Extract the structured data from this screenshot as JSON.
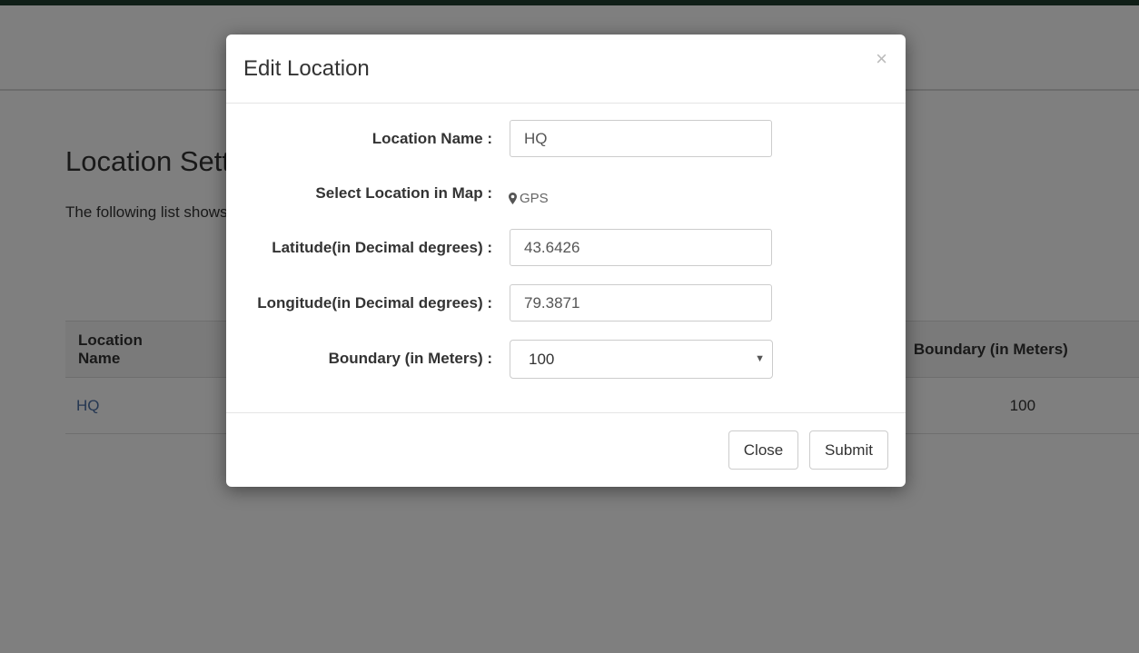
{
  "page": {
    "title": "Location Settings",
    "description": "The following list shows",
    "table": {
      "headers": {
        "name": "Location Name",
        "boundary": "Boundary (in Meters)"
      },
      "rows": [
        {
          "name": "HQ",
          "boundary": "100"
        }
      ]
    }
  },
  "modal": {
    "title": "Edit Location",
    "close_symbol": "×",
    "fields": {
      "location_name": {
        "label": "Location Name :",
        "value": "HQ"
      },
      "map": {
        "label": "Select Location in Map :",
        "link": "GPS"
      },
      "latitude": {
        "label": "Latitude(in Decimal degrees) :",
        "value": "43.6426"
      },
      "longitude": {
        "label": "Longitude(in Decimal degrees) :",
        "value": "79.3871"
      },
      "boundary": {
        "label": "Boundary (in Meters) :",
        "value": "100"
      }
    },
    "buttons": {
      "close": "Close",
      "submit": "Submit"
    }
  },
  "icons": {
    "gps": "map-pin-icon",
    "select": "caret-down-icon",
    "close": "close-icon"
  },
  "colors": {
    "top_strip": "#1f3d2e",
    "link": "#4a6fa5",
    "overlay": "rgba(0,0,0,0.5)"
  }
}
